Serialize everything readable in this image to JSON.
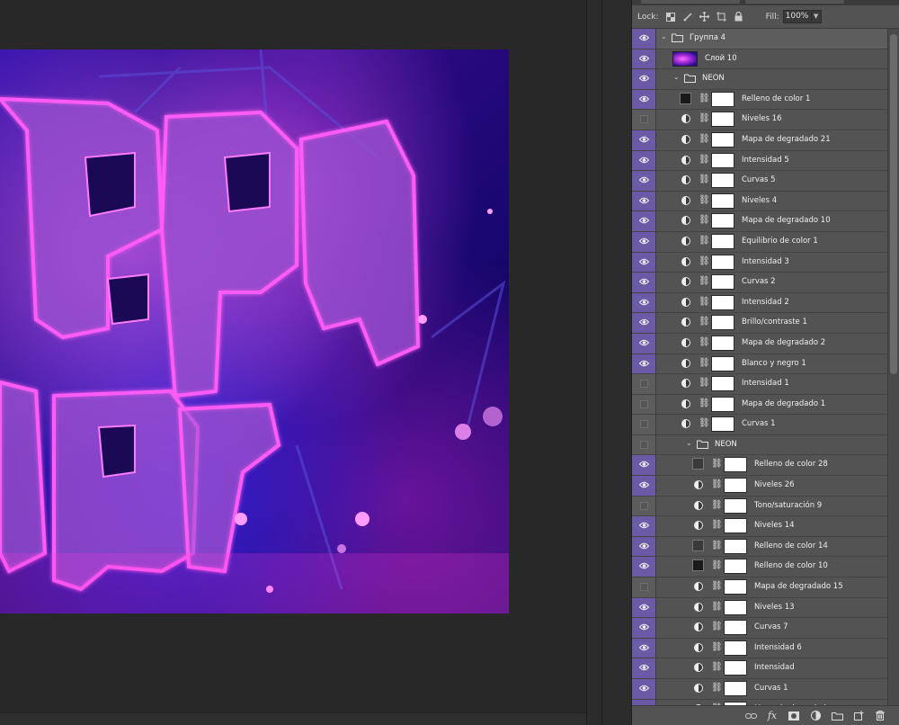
{
  "lock_bar": {
    "lock_label": "Lock:",
    "fill_label": "Fill:",
    "fill_value": "100%"
  },
  "layers": [
    {
      "name": "Группа 4",
      "type": "group",
      "indent": 0,
      "visible": true,
      "expanded": true
    },
    {
      "name": "Слой 10",
      "type": "pixel",
      "indent": 0,
      "visible": true
    },
    {
      "name": "NEON",
      "type": "group",
      "indent": 1,
      "visible": true,
      "expanded": true
    },
    {
      "name": "Relleno de color 1",
      "type": "fill",
      "indent": 1,
      "visible": true,
      "swatch": "#1a1a1a"
    },
    {
      "name": "Niveles 16",
      "type": "adjustment",
      "indent": 1,
      "visible": false
    },
    {
      "name": "Mapa de degradado 21",
      "type": "adjustment",
      "indent": 1,
      "visible": true
    },
    {
      "name": "Intensidad 5",
      "type": "adjustment",
      "indent": 1,
      "visible": true
    },
    {
      "name": "Curvas 5",
      "type": "adjustment",
      "indent": 1,
      "visible": true
    },
    {
      "name": "Niveles 4",
      "type": "adjustment",
      "indent": 1,
      "visible": true
    },
    {
      "name": "Mapa de degradado 10",
      "type": "adjustment",
      "indent": 1,
      "visible": true
    },
    {
      "name": "Equilibrio de color 1",
      "type": "adjustment",
      "indent": 1,
      "visible": true
    },
    {
      "name": "Intensidad 3",
      "type": "adjustment",
      "indent": 1,
      "visible": true
    },
    {
      "name": "Curvas 2",
      "type": "adjustment",
      "indent": 1,
      "visible": true
    },
    {
      "name": "Intensidad 2",
      "type": "adjustment",
      "indent": 1,
      "visible": true
    },
    {
      "name": "Brillo/contraste 1",
      "type": "adjustment",
      "indent": 1,
      "visible": true
    },
    {
      "name": "Mapa de degradado 2",
      "type": "adjustment",
      "indent": 1,
      "visible": true
    },
    {
      "name": "Blanco y negro 1",
      "type": "adjustment",
      "indent": 1,
      "visible": true
    },
    {
      "name": "Intensidad 1",
      "type": "adjustment",
      "indent": 1,
      "visible": false
    },
    {
      "name": "Mapa de degradado 1",
      "type": "adjustment",
      "indent": 1,
      "visible": false
    },
    {
      "name": "Curvas 1",
      "type": "adjustment",
      "indent": 1,
      "visible": false
    },
    {
      "name": "NEON",
      "type": "group",
      "indent": 2,
      "visible": false,
      "expanded": true
    },
    {
      "name": "Relleno de color 28",
      "type": "fill",
      "indent": 2,
      "visible": true,
      "swatch": "#3a3a3a"
    },
    {
      "name": "Niveles 26",
      "type": "adjustment",
      "indent": 2,
      "visible": true
    },
    {
      "name": "Tono/saturación 9",
      "type": "adjustment",
      "indent": 2,
      "visible": false
    },
    {
      "name": "Niveles 14",
      "type": "adjustment",
      "indent": 2,
      "visible": true
    },
    {
      "name": "Relleno de color 14",
      "type": "fill",
      "indent": 2,
      "visible": true,
      "swatch": "#3a3a3a"
    },
    {
      "name": "Relleno de color 10",
      "type": "fill",
      "indent": 2,
      "visible": true,
      "swatch": "#1a1a1a"
    },
    {
      "name": "Mapa de degradado 15",
      "type": "adjustment",
      "indent": 2,
      "visible": false
    },
    {
      "name": "Niveles 13",
      "type": "adjustment",
      "indent": 2,
      "visible": true
    },
    {
      "name": "Curvas 7",
      "type": "adjustment",
      "indent": 2,
      "visible": true
    },
    {
      "name": "Intensidad 6",
      "type": "adjustment",
      "indent": 2,
      "visible": true
    },
    {
      "name": "Intensidad",
      "type": "adjustment",
      "indent": 2,
      "visible": true
    },
    {
      "name": "Curvas 1",
      "type": "adjustment",
      "indent": 2,
      "visible": true
    },
    {
      "name": "Mapa de degradado",
      "type": "adjustment",
      "indent": 2,
      "visible": true
    }
  ],
  "bottom_bar": {
    "icons": [
      "link-layers-icon",
      "fx-icon",
      "add-mask-icon",
      "adjustment-layer-icon",
      "new-group-icon",
      "new-layer-icon",
      "delete-layer-icon"
    ]
  },
  "colors": {
    "eye_column": "#6b5aa6",
    "panel_bg": "#535353",
    "workspace_bg": "#282828"
  }
}
